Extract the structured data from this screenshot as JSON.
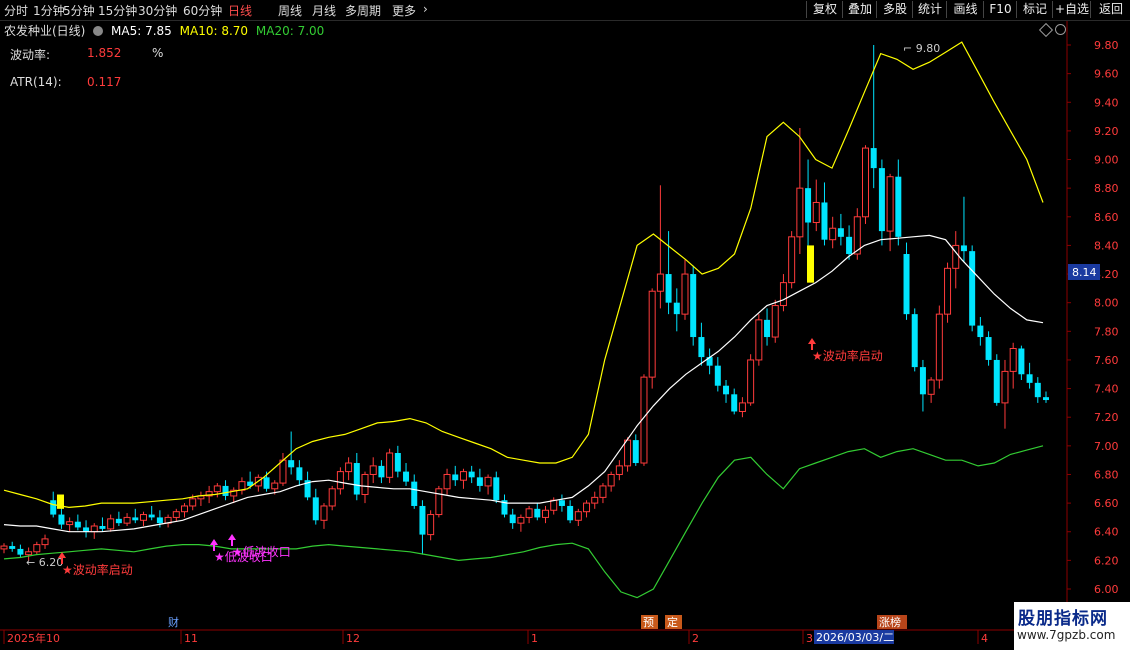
{
  "toolbar": {
    "periods": [
      "分时",
      "1分钟",
      "5分钟",
      "15分钟",
      "30分钟",
      "60分钟",
      "日线",
      "周线",
      "月线",
      "多周期",
      "更多"
    ],
    "active": "日线",
    "right": [
      "复权",
      "叠加",
      "多股",
      "统计",
      "画线",
      "F10",
      "标记",
      "+自选",
      "返回"
    ]
  },
  "legend": {
    "title": "农发种业(日线)",
    "ma5": "MA5: 7.85",
    "ma10": "MA10: 8.70",
    "ma20": "MA20: 7.00",
    "ma5_color": "#ffffff",
    "ma10_color": "#ffff00",
    "ma20_color": "#33cc33"
  },
  "indicators": [
    {
      "label": "波动率:",
      "value": "1.852",
      "unit": "%"
    },
    {
      "label": "ATR(14):",
      "value": "0.117"
    }
  ],
  "colors": {
    "up": "#ff3b3b",
    "down": "#00e5ff",
    "boll_upper": "#ffff00",
    "boll_mid": "#ffffff",
    "boll_lower": "#33cc33",
    "axis": "#8b0000",
    "signal": "#ff3b3b",
    "signal2": "#ff33ff",
    "highlight": "#ffff00"
  },
  "watermark": {
    "text": "股朋指标网",
    "url": "www.7gpzb.com"
  },
  "chart_data": {
    "type": "candlestick",
    "ylim": [
      5.92,
      9.92
    ],
    "yticks": [
      "9.80",
      "9.60",
      "9.40",
      "9.20",
      "9.00",
      "8.80",
      "8.60",
      "8.40",
      "8.20",
      "8.00",
      "7.80",
      "7.60",
      "7.40",
      "7.20",
      "7.00",
      "6.80",
      "6.60",
      "6.40",
      "6.20",
      "6.00"
    ],
    "current_price": "8.14",
    "high_label": "9.80",
    "low_label": "6.20",
    "date_labels": [
      "2025年10",
      "11",
      "12",
      "1",
      "2",
      "3",
      "4"
    ],
    "cursor_date": "2026/03/03/二",
    "event_tags": [
      "财",
      "预",
      "定",
      "涨榜"
    ],
    "signals": [
      {
        "text": "★波动率启动",
        "color": "#ff3b3b"
      },
      {
        "text": "★低波收口",
        "color": "#ff33ff"
      },
      {
        "text": "★低波收口",
        "color": "#ff33ff"
      },
      {
        "text": "★波动率启动",
        "color": "#ff3b3b"
      }
    ],
    "candles": [
      [
        6.28,
        6.32,
        6.25,
        6.3
      ],
      [
        6.3,
        6.33,
        6.26,
        6.28
      ],
      [
        6.28,
        6.31,
        6.22,
        6.24
      ],
      [
        6.24,
        6.29,
        6.2,
        6.26
      ],
      [
        6.26,
        6.33,
        6.24,
        6.31
      ],
      [
        6.31,
        6.38,
        6.28,
        6.35
      ],
      [
        6.62,
        6.68,
        6.5,
        6.52
      ],
      [
        6.52,
        6.58,
        6.42,
        6.45
      ],
      [
        6.45,
        6.5,
        6.4,
        6.47
      ],
      [
        6.47,
        6.52,
        6.41,
        6.43
      ],
      [
        6.43,
        6.48,
        6.36,
        6.4
      ],
      [
        6.4,
        6.46,
        6.35,
        6.44
      ],
      [
        6.44,
        6.5,
        6.4,
        6.42
      ],
      [
        6.42,
        6.52,
        6.4,
        6.49
      ],
      [
        6.49,
        6.54,
        6.44,
        6.46
      ],
      [
        6.46,
        6.53,
        6.44,
        6.5
      ],
      [
        6.5,
        6.56,
        6.46,
        6.48
      ],
      [
        6.48,
        6.54,
        6.44,
        6.52
      ],
      [
        6.52,
        6.58,
        6.48,
        6.5
      ],
      [
        6.5,
        6.55,
        6.43,
        6.46
      ],
      [
        6.46,
        6.52,
        6.43,
        6.5
      ],
      [
        6.5,
        6.56,
        6.47,
        6.54
      ],
      [
        6.54,
        6.6,
        6.5,
        6.58
      ],
      [
        6.58,
        6.66,
        6.55,
        6.63
      ],
      [
        6.63,
        6.68,
        6.58,
        6.65
      ],
      [
        6.65,
        6.72,
        6.6,
        6.68
      ],
      [
        6.68,
        6.74,
        6.64,
        6.72
      ],
      [
        6.72,
        6.76,
        6.62,
        6.65
      ],
      [
        6.65,
        6.71,
        6.6,
        6.69
      ],
      [
        6.69,
        6.78,
        6.66,
        6.75
      ],
      [
        6.75,
        6.82,
        6.7,
        6.72
      ],
      [
        6.72,
        6.8,
        6.68,
        6.78
      ],
      [
        6.78,
        6.82,
        6.68,
        6.7
      ],
      [
        6.7,
        6.76,
        6.66,
        6.74
      ],
      [
        6.74,
        6.95,
        6.72,
        6.9
      ],
      [
        6.9,
        7.1,
        6.8,
        6.85
      ],
      [
        6.85,
        6.9,
        6.72,
        6.76
      ],
      [
        6.76,
        6.82,
        6.62,
        6.64
      ],
      [
        6.64,
        6.7,
        6.45,
        6.48
      ],
      [
        6.48,
        6.6,
        6.42,
        6.58
      ],
      [
        6.58,
        6.72,
        6.55,
        6.7
      ],
      [
        6.7,
        6.85,
        6.66,
        6.82
      ],
      [
        6.82,
        6.92,
        6.76,
        6.88
      ],
      [
        6.88,
        6.95,
        6.62,
        6.66
      ],
      [
        6.66,
        6.82,
        6.6,
        6.8
      ],
      [
        6.8,
        6.92,
        6.74,
        6.86
      ],
      [
        6.86,
        6.9,
        6.74,
        6.78
      ],
      [
        6.78,
        6.98,
        6.74,
        6.95
      ],
      [
        6.95,
        7.0,
        6.78,
        6.82
      ],
      [
        6.82,
        6.88,
        6.72,
        6.75
      ],
      [
        6.75,
        6.8,
        6.56,
        6.58
      ],
      [
        6.58,
        6.62,
        6.24,
        6.38
      ],
      [
        6.38,
        6.55,
        6.34,
        6.52
      ],
      [
        6.52,
        6.72,
        6.5,
        6.7
      ],
      [
        6.7,
        6.84,
        6.66,
        6.8
      ],
      [
        6.8,
        6.86,
        6.72,
        6.76
      ],
      [
        6.76,
        6.84,
        6.7,
        6.82
      ],
      [
        6.82,
        6.86,
        6.74,
        6.78
      ],
      [
        6.78,
        6.84,
        6.68,
        6.72
      ],
      [
        6.72,
        6.8,
        6.66,
        6.78
      ],
      [
        6.78,
        6.82,
        6.6,
        6.62
      ],
      [
        6.62,
        6.66,
        6.5,
        6.52
      ],
      [
        6.52,
        6.56,
        6.42,
        6.46
      ],
      [
        6.46,
        6.52,
        6.4,
        6.5
      ],
      [
        6.5,
        6.58,
        6.46,
        6.56
      ],
      [
        6.56,
        6.6,
        6.48,
        6.5
      ],
      [
        6.5,
        6.58,
        6.46,
        6.55
      ],
      [
        6.55,
        6.64,
        6.52,
        6.62
      ],
      [
        6.62,
        6.66,
        6.54,
        6.58
      ],
      [
        6.58,
        6.62,
        6.46,
        6.48
      ],
      [
        6.48,
        6.56,
        6.44,
        6.54
      ],
      [
        6.54,
        6.62,
        6.5,
        6.6
      ],
      [
        6.6,
        6.68,
        6.56,
        6.64
      ],
      [
        6.64,
        6.74,
        6.6,
        6.72
      ],
      [
        6.72,
        6.82,
        6.68,
        6.8
      ],
      [
        6.8,
        6.9,
        6.76,
        6.86
      ],
      [
        6.86,
        7.06,
        6.82,
        7.04
      ],
      [
        7.04,
        7.08,
        6.86,
        6.88
      ],
      [
        6.88,
        7.5,
        6.86,
        7.48
      ],
      [
        7.48,
        8.1,
        7.4,
        8.08
      ],
      [
        8.08,
        8.82,
        7.96,
        8.2
      ],
      [
        8.2,
        8.5,
        7.92,
        8.0
      ],
      [
        8.0,
        8.1,
        7.8,
        7.92
      ],
      [
        7.92,
        8.3,
        7.88,
        8.2
      ],
      [
        8.2,
        8.26,
        7.7,
        7.76
      ],
      [
        7.76,
        7.86,
        7.56,
        7.62
      ],
      [
        7.62,
        7.68,
        7.5,
        7.56
      ],
      [
        7.56,
        7.62,
        7.38,
        7.42
      ],
      [
        7.42,
        7.46,
        7.3,
        7.36
      ],
      [
        7.36,
        7.4,
        7.22,
        7.24
      ],
      [
        7.24,
        7.34,
        7.2,
        7.3
      ],
      [
        7.3,
        7.64,
        7.28,
        7.6
      ],
      [
        7.6,
        7.92,
        7.56,
        7.88
      ],
      [
        7.88,
        7.96,
        7.7,
        7.76
      ],
      [
        7.76,
        8.02,
        7.72,
        7.98
      ],
      [
        7.98,
        8.2,
        7.94,
        8.14
      ],
      [
        8.14,
        8.5,
        8.1,
        8.46
      ],
      [
        8.46,
        9.22,
        8.34,
        8.8
      ],
      [
        8.8,
        9.0,
        8.4,
        8.56
      ],
      [
        8.56,
        8.86,
        8.5,
        8.7
      ],
      [
        8.7,
        8.84,
        8.4,
        8.44
      ],
      [
        8.44,
        8.6,
        8.38,
        8.52
      ],
      [
        8.52,
        8.62,
        8.4,
        8.46
      ],
      [
        8.46,
        8.54,
        8.3,
        8.34
      ],
      [
        8.34,
        8.66,
        8.3,
        8.6
      ],
      [
        8.6,
        9.1,
        8.55,
        9.08
      ],
      [
        9.08,
        9.8,
        8.8,
        8.94
      ],
      [
        8.94,
        9.0,
        8.4,
        8.5
      ],
      [
        8.5,
        8.9,
        8.36,
        8.88
      ],
      [
        8.88,
        9.0,
        8.4,
        8.46
      ],
      [
        8.34,
        8.42,
        7.88,
        7.92
      ],
      [
        7.92,
        7.96,
        7.52,
        7.55
      ],
      [
        7.55,
        7.6,
        7.24,
        7.36
      ],
      [
        7.36,
        7.48,
        7.3,
        7.46
      ],
      [
        7.46,
        7.98,
        7.4,
        7.92
      ],
      [
        7.92,
        8.28,
        7.86,
        8.24
      ],
      [
        8.24,
        8.5,
        8.1,
        8.4
      ],
      [
        8.4,
        8.74,
        8.28,
        8.36
      ],
      [
        8.36,
        8.4,
        7.8,
        7.84
      ],
      [
        7.84,
        7.9,
        7.7,
        7.76
      ],
      [
        7.76,
        7.8,
        7.56,
        7.6
      ],
      [
        7.6,
        7.64,
        7.28,
        7.3
      ],
      [
        7.3,
        7.6,
        7.12,
        7.52
      ],
      [
        7.52,
        7.72,
        7.4,
        7.68
      ],
      [
        7.68,
        7.7,
        7.46,
        7.5
      ],
      [
        7.5,
        7.58,
        7.4,
        7.44
      ],
      [
        7.44,
        7.48,
        7.3,
        7.34
      ],
      [
        7.34,
        7.38,
        7.3,
        7.32
      ]
    ],
    "boll_upper": [
      6.69,
      6.66,
      6.63,
      6.59,
      6.57,
      6.58,
      6.6,
      6.6,
      6.6,
      6.61,
      6.62,
      6.63,
      6.65,
      6.66,
      6.68,
      6.7,
      6.78,
      6.88,
      6.98,
      7.03,
      7.06,
      7.08,
      7.12,
      7.16,
      7.17,
      7.19,
      7.16,
      7.1,
      7.06,
      7.02,
      6.98,
      6.92,
      6.9,
      6.88,
      6.88,
      6.92,
      7.08,
      7.6,
      8.0,
      8.4,
      8.48,
      8.39,
      8.3,
      8.2,
      8.24,
      8.34,
      8.66,
      9.16,
      9.26,
      9.16,
      9.0,
      8.94,
      9.2,
      9.47,
      9.74,
      9.7,
      9.63,
      9.68,
      9.75,
      9.82,
      9.61,
      9.4,
      9.2,
      9.0,
      8.7
    ],
    "boll_mid": [
      6.45,
      6.44,
      6.44,
      6.42,
      6.4,
      6.4,
      6.4,
      6.41,
      6.42,
      6.44,
      6.46,
      6.48,
      6.52,
      6.56,
      6.6,
      6.64,
      6.66,
      6.68,
      6.72,
      6.75,
      6.76,
      6.74,
      6.72,
      6.71,
      6.7,
      6.7,
      6.68,
      6.66,
      6.64,
      6.63,
      6.62,
      6.6,
      6.6,
      6.6,
      6.62,
      6.64,
      6.72,
      6.82,
      6.98,
      7.14,
      7.28,
      7.4,
      7.5,
      7.58,
      7.66,
      7.76,
      7.88,
      7.98,
      8.02,
      8.08,
      8.14,
      8.22,
      8.32,
      8.4,
      8.44,
      8.45,
      8.46,
      8.47,
      8.44,
      8.3,
      8.18,
      8.06,
      7.96,
      7.88,
      7.86
    ],
    "boll_lower": [
      6.21,
      6.22,
      6.24,
      6.25,
      6.26,
      6.27,
      6.28,
      6.27,
      6.26,
      6.28,
      6.3,
      6.31,
      6.31,
      6.3,
      6.28,
      6.28,
      6.28,
      6.28,
      6.28,
      6.3,
      6.31,
      6.3,
      6.29,
      6.28,
      6.27,
      6.26,
      6.24,
      6.22,
      6.2,
      6.21,
      6.22,
      6.24,
      6.26,
      6.29,
      6.31,
      6.32,
      6.28,
      6.12,
      5.98,
      5.94,
      6.0,
      6.2,
      6.4,
      6.6,
      6.78,
      6.9,
      6.92,
      6.8,
      6.7,
      6.84,
      6.88,
      6.92,
      6.96,
      6.98,
      6.92,
      6.96,
      6.98,
      6.94,
      6.9,
      6.9,
      6.86,
      6.88,
      6.94,
      6.97,
      7.0
    ]
  }
}
